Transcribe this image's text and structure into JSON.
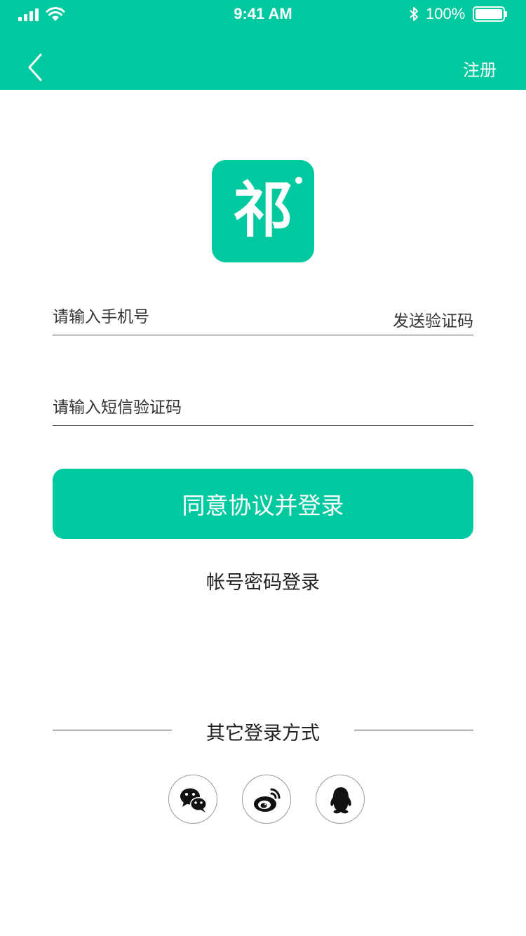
{
  "status_bar": {
    "time": "9:41 AM",
    "battery": "100%"
  },
  "nav": {
    "register": "注册"
  },
  "logo": {
    "char": "祁"
  },
  "form": {
    "phone_placeholder": "请输入手机号",
    "send_code": "发送验证码",
    "code_placeholder": "请输入短信验证码",
    "submit": "同意协议并登录",
    "password_login": "帐号密码登录"
  },
  "other_login": {
    "title": "其它登录方式",
    "providers": [
      "wechat",
      "weibo",
      "qq"
    ]
  },
  "colors": {
    "primary": "#00c9a0",
    "text": "#222222"
  }
}
